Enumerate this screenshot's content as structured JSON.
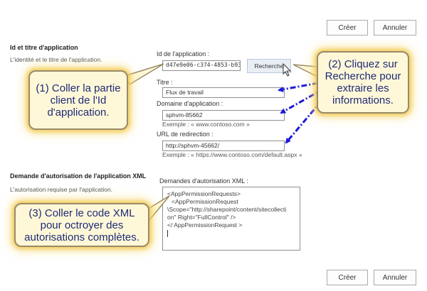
{
  "top_buttons": {
    "create": "Créer",
    "cancel": "Annuler"
  },
  "bottom_buttons": {
    "create": "Créer",
    "cancel": "Annuler"
  },
  "section1": {
    "title": "Id et titre d'application",
    "description": "L'identité et le titre de l'application."
  },
  "fields": {
    "app_id": {
      "label": "Id de l'application :",
      "value": "d47e9e06-c374-4853-b93b-"
    },
    "search_button": "Recherche",
    "title": {
      "label": "Titre :",
      "value": "Flux de travail"
    },
    "domain": {
      "label": "Domaine d'application :",
      "value": "sphvm-85662",
      "hint": "Exemple : « www.contoso.com »"
    },
    "redirect": {
      "label": "URL de redirection :",
      "value": "http://sphvm-45662/",
      "hint": "Exemple : « https://www.contoso.com/default.aspx »"
    }
  },
  "section2": {
    "title": "Demande d'autorisation de l'application XML",
    "description": "L'autorisation requise par l'application."
  },
  "permissions": {
    "label": "Demandes d'autorisation XML :",
    "lines": [
      "<AppPermissionRequests>",
      "<AppPermissionRequest",
      "\\Scope=\"http://sharepoint/content/sitecollecti",
      "on\" Right=\"FullControl\" />",
      "</ AppPermissionRequest >"
    ]
  },
  "callouts": {
    "one": [
      "(1) Coller la partie",
      "client de l'Id",
      "d'application."
    ],
    "two": [
      "(2) Cliquez sur",
      "Recherche pour",
      "extraire les",
      "informations."
    ],
    "three": [
      "(3) Coller le code XML",
      "pour octroyer des",
      "autorisations complètes."
    ]
  }
}
